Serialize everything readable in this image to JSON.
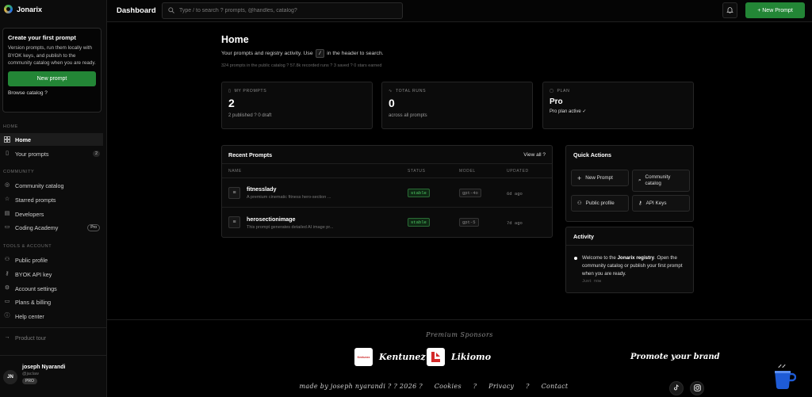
{
  "app": {
    "name": "Jonarix"
  },
  "header": {
    "title": "Dashboard",
    "search_placeholder": "Type / to search ? prompts, @handles, catalog?",
    "new_prompt_label": "+ New Prompt"
  },
  "sidebar": {
    "promo": {
      "title": "Create your first prompt",
      "text": "Version prompts, run them locally with BYOK keys, and publish to the community catalog when you are ready.",
      "button": "New prompt",
      "link": "Browse catalog ?"
    },
    "sections": {
      "home": "HOME",
      "community": "COMMUNITY",
      "tools": "TOOLS & ACCOUNT"
    },
    "home_items": [
      {
        "label": "Home",
        "icon": "grid-icon"
      },
      {
        "label": "Your prompts",
        "icon": "document-icon",
        "count": "2"
      }
    ],
    "community_items": [
      {
        "label": "Community catalog",
        "icon": "compass-icon"
      },
      {
        "label": "Starred prompts",
        "icon": "star-icon"
      },
      {
        "label": "Developers",
        "icon": "code-icon"
      },
      {
        "label": "Coding Academy",
        "icon": "book-icon",
        "badge": "Pro"
      }
    ],
    "tools_items": [
      {
        "label": "Public profile",
        "icon": "user-icon"
      },
      {
        "label": "BYOK API key",
        "icon": "key-icon"
      },
      {
        "label": "Account settings",
        "icon": "gear-icon"
      },
      {
        "label": "Plans & billing",
        "icon": "card-icon"
      },
      {
        "label": "Help center",
        "icon": "help-icon"
      }
    ],
    "product_tour": "Product tour",
    "user": {
      "initials": "JN",
      "name": "joseph Nyarandi",
      "handle": "@jaclaw",
      "tier": "PRO"
    }
  },
  "main": {
    "title": "Home",
    "subtitle_pre": "Your prompts and registry activity. Use",
    "subtitle_key": "/",
    "subtitle_post": "in the header to search.",
    "stats_line": "324 prompts in the public catalog ? 57.8k recorded runs ? 3 saved ? 0 stars earned",
    "cards": [
      {
        "label": "MY PROMPTS",
        "value": "2",
        "note": "2 published ? 0 draft",
        "icon": "document-icon"
      },
      {
        "label": "TOTAL RUNS",
        "value": "0",
        "note": "across all prompts",
        "icon": "activity-icon"
      },
      {
        "label": "PLAN",
        "value": "Pro",
        "note": "Pro plan active ✓",
        "icon": "box-icon"
      }
    ],
    "recent": {
      "title": "Recent Prompts",
      "view_all": "View all ?",
      "columns": [
        "NAME",
        "STATUS",
        "MODEL",
        "UPDATED"
      ],
      "rows": [
        {
          "name": "fitnesslady",
          "desc": "A premium cinematic fitness hero-section ...",
          "status": "stable",
          "model": "gpt-4o",
          "updated": "6d ago"
        },
        {
          "name": "herosectionimage",
          "desc": "This prompt generates detailed AI image pr...",
          "status": "stable",
          "model": "gpt-5",
          "updated": "7d ago"
        }
      ]
    },
    "quick_actions": {
      "title": "Quick Actions",
      "items": [
        {
          "label": "New Prompt",
          "icon": "plus-icon"
        },
        {
          "label": "Community catalog",
          "icon": "search-icon"
        },
        {
          "label": "Public profile",
          "icon": "user-icon"
        },
        {
          "label": "API Keys",
          "icon": "key-icon"
        }
      ]
    },
    "activity": {
      "title": "Activity",
      "text_pre": "Welcome to the ",
      "text_bold": "Jonarix registry",
      "text_post": ". Open the community catalog or publish your first prompt when you are ready.",
      "time": "Just now"
    }
  },
  "footer": {
    "sponsors_title": "Premium Sponsors",
    "sponsors": [
      {
        "name": "Kentunez",
        "logo_text": "Kentunez"
      },
      {
        "name": "Likiomo"
      }
    ],
    "promote": "Promote your brand",
    "credit": "made by joseph nyarandi ? ? 2026 ?",
    "links": [
      "Cookies",
      "Privacy",
      "Contact"
    ],
    "link_sep": "?"
  },
  "colors": {
    "accent": "#238636",
    "status_green": "#4ec764",
    "likiomo_red": "#d42a2a"
  }
}
